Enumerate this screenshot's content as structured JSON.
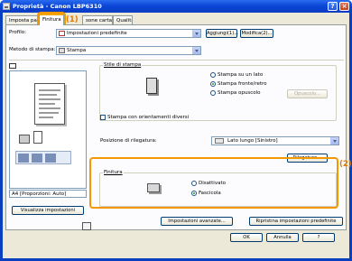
{
  "window": {
    "title": "Proprietà - Canon LBP6310",
    "help_label": "?",
    "close_label": "×"
  },
  "tabs": [
    {
      "label": "Imposta pagina"
    },
    {
      "label": "Finitura"
    },
    {
      "label": "sone carta"
    },
    {
      "label": "Qualità"
    }
  ],
  "callouts": {
    "first": "(1)",
    "second": "(2)"
  },
  "profile": {
    "label": "Profilo:",
    "value": "Impostazioni predefinite",
    "add_button": "Aggiungi(1)...",
    "edit_button": "Modifica(2)..."
  },
  "output_method": {
    "label": "Metodo di stampa:",
    "value": "Stampa"
  },
  "preview": {
    "paper_caption": "A4 [Proporzioni: Auto]",
    "view_settings_button": "Visualizza impostazioni"
  },
  "print_style": {
    "label": "Stile di stampa",
    "options": [
      "Stampa su un lato",
      "Stampa fronte/retro",
      "Stampa opuscolo"
    ],
    "selected_index": 1,
    "booklet_button": "Opuscolo..."
  },
  "mixed_orientation": {
    "label": "Stampa con orientamenti diversi",
    "checked": false
  },
  "binding": {
    "label": "Posizione di rilegatura:",
    "value": "Lato lungo [Sinistro]",
    "button": "Rilegatura..."
  },
  "finishing": {
    "label": "Finitura",
    "options": [
      "Disattivato",
      "Fascicola"
    ],
    "selected_index": 1
  },
  "advanced_button": "Impostazioni avanzate...",
  "restore_button": "Ripristina impostazioni predefinite",
  "dialog_buttons": {
    "ok": "OK",
    "cancel": "Annulla",
    "help": "?"
  }
}
